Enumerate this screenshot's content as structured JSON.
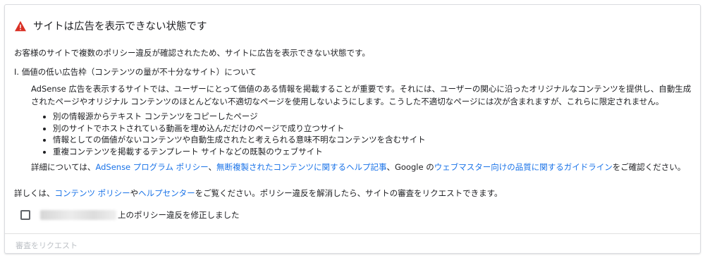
{
  "header": {
    "icon": "warning-icon",
    "icon_color": "#d93025",
    "title": "サイトは広告を表示できない状態です"
  },
  "intro": "お客様のサイトで複数のポリシー違反が確認されたため、サイトに広告を表示できない状態です。",
  "section": {
    "title": "I. 価値の低い広告枠（コンテンツの量が不十分なサイト）について",
    "description": "AdSense 広告を表示するサイトでは、ユーザーにとって価値のある情報を掲載することが重要です。それには、ユーザーの関心に沿ったオリジナルなコンテンツを提供し、自動生成されたページやオリジナル コンテンツのほとんどない不適切なページを使用しないようにします。こうした不適切なページには次が含まれますが、これらに限定されません。",
    "bullets": [
      "別の情報源からテキスト コンテンツをコピーしたページ",
      "別のサイトでホストされている動画を埋め込んだだけのページで成り立つサイト",
      "情報としての価値がないコンテンツや自動生成されたと考えられる意味不明なコンテンツを含むサイト",
      "重複コンテンツを掲載するテンプレート サイトなどの既製のウェブサイト"
    ],
    "details": {
      "prefix": "詳細については、",
      "link1": "AdSense プログラム ポリシー",
      "sep1": "、",
      "link2": "無断複製されたコンテンツに関するヘルプ記事",
      "mid": "、Google の",
      "link3": "ウェブマスター向けの品質に関するガイドライン",
      "suffix": "をご確認ください。"
    }
  },
  "more": {
    "prefix": "詳しくは、",
    "link1": "コンテンツ ポリシー",
    "mid": "や",
    "link2": "ヘルプセンター",
    "suffix": "をご覧ください。ポリシー違反を解消したら、サイトの審査をリクエストできます。"
  },
  "checkbox": {
    "checked": false,
    "label": "上のポリシー違反を修正しました"
  },
  "footer": {
    "request_button": "審査をリクエスト",
    "request_enabled": false
  },
  "colors": {
    "link": "#1a73e8",
    "disabled_text": "#bdc1c6",
    "warning": "#d93025"
  }
}
